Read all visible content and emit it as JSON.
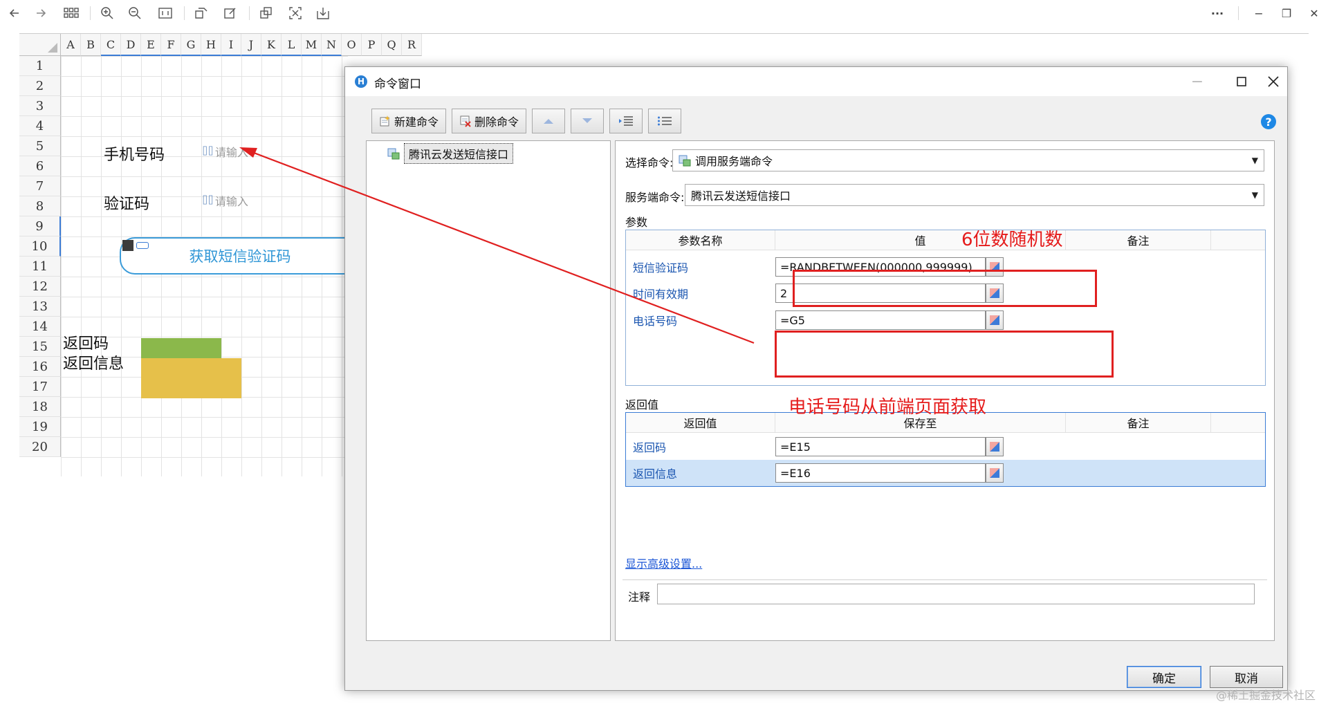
{
  "viewer_toolbar": {
    "icons": [
      "back-arrow-icon",
      "forward-arrow-icon",
      "grid-icon",
      "zoom-in-icon",
      "zoom-out-icon",
      "fit-width-icon",
      "rotate-icon",
      "edit-icon",
      "copy-icon",
      "screenshot-icon",
      "download-icon"
    ],
    "more": "···",
    "minimize": "−",
    "restore": "❐",
    "close": "✕"
  },
  "sheet": {
    "columns": [
      "A",
      "B",
      "C",
      "D",
      "E",
      "F",
      "G",
      "H",
      "I",
      "J",
      "K",
      "L",
      "M",
      "N",
      "O",
      "P",
      "Q",
      "R"
    ],
    "rows": [
      "1",
      "2",
      "3",
      "4",
      "5",
      "6",
      "7",
      "8",
      "9",
      "10",
      "11",
      "12",
      "13",
      "14",
      "15",
      "16",
      "17",
      "18",
      "19",
      "20"
    ],
    "labels": {
      "phone": "手机号码",
      "code": "验证码",
      "return_code": "返回码",
      "return_info": "返回信息"
    },
    "input_placeholder": "请输入",
    "sms_button": "获取短信验证码",
    "colors": {
      "return_code_cell": "#8bb84b",
      "return_info_cell": "#e6c04a"
    }
  },
  "dialog": {
    "title": "命令窗口",
    "toolbar": {
      "new_command": "新建命令",
      "delete_command": "删除命令"
    },
    "tree_item": "腾讯云发送短信接口",
    "select_command_label": "选择命令:",
    "select_command_value": "调用服务端命令",
    "server_command_label": "服务端命令:",
    "server_command_value": "腾讯云发送短信接口",
    "params_title": "参数",
    "params_headers": [
      "参数名称",
      "值",
      "备注"
    ],
    "params": [
      {
        "name": "短信验证码",
        "value": "=RANDBETWEEN(000000,999999)"
      },
      {
        "name": "时间有效期",
        "value": "2"
      },
      {
        "name": "电话号码",
        "value": "=G5"
      }
    ],
    "returns_title": "返回值",
    "returns_headers": [
      "返回值",
      "保存至",
      "备注"
    ],
    "returns": [
      {
        "name": "返回码",
        "value": "=E15"
      },
      {
        "name": "返回信息",
        "value": "=E16"
      }
    ],
    "advanced_link": "显示高级设置...",
    "note_label": "注释",
    "ok": "确定",
    "cancel": "取消"
  },
  "annotations": {
    "random_note": "6位数随机数",
    "phone_note": "电话号码从前端页面获取",
    "color": "#e02020"
  },
  "watermark": "@稀土掘金技术社区"
}
